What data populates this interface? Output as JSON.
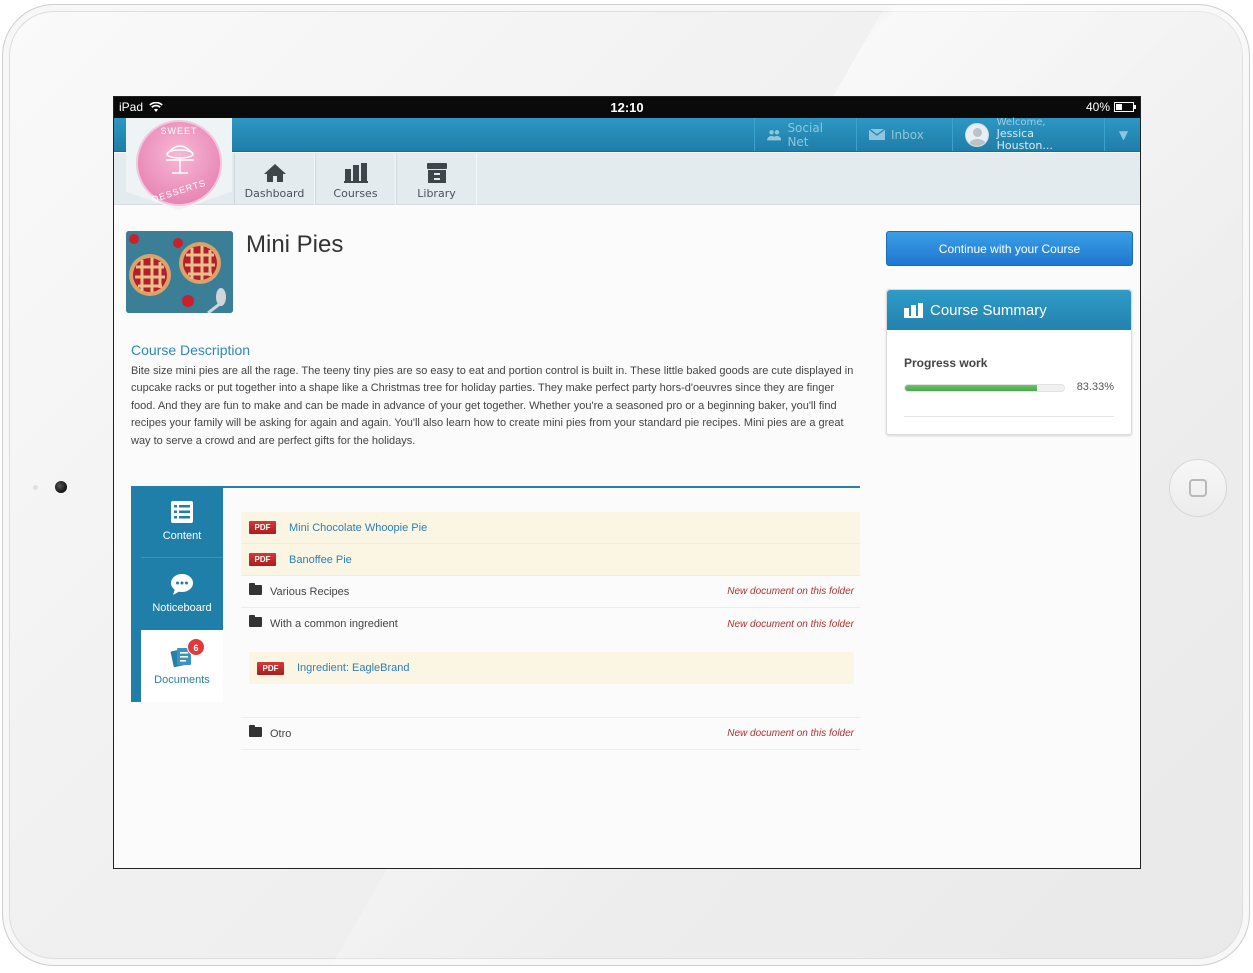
{
  "status_bar": {
    "device": "iPad",
    "time": "12:10",
    "battery": "40%",
    "battery_level": 0.4
  },
  "logo": {
    "top_text": "SWEET",
    "bottom_text": "DESSERTS"
  },
  "topbar": {
    "social_label": "Social Net",
    "inbox_label": "Inbox",
    "welcome_label": "Welcome,",
    "user_name": "Jessica Houston..."
  },
  "nav": {
    "dashboard": "Dashboard",
    "courses": "Courses",
    "library": "Library"
  },
  "course": {
    "title": "Mini Pies",
    "description_title": "Course Description",
    "description": "Bite size mini pies are all the rage. The teeny tiny pies are so easy to eat and portion control is built in. These little baked goods are cute displayed in cupcake racks or put together into a shape like a Christmas tree for holiday parties. They make perfect party hors-d'oeuvres since they are finger food. And they are fun to make and can be made in advance of your get together. Whether you're a seasoned pro or a beginning baker, you'll find recipes your family will be asking for again and again. You'll also learn how to create mini pies from your standard pie recipes. Mini pies are a great way to serve a crowd and are perfect gifts for the holidays."
  },
  "sidebar": {
    "continue_button": "Continue with your Course",
    "summary_title": "Course Summary",
    "progress_label": "Progress work",
    "progress_value": "83.33%",
    "progress_fraction": 0.8333
  },
  "tabs": {
    "content": "Content",
    "noticeboard": "Noticeboard",
    "documents": "Documents",
    "documents_badge": "6"
  },
  "documents": {
    "pdf_label": "PDF",
    "folder_note": "New document on this folder",
    "items": [
      {
        "kind": "pdf",
        "name": "Mini Chocolate Whoopie Pie"
      },
      {
        "kind": "pdf",
        "name": "Banoffee Pie"
      },
      {
        "kind": "folder",
        "name": "Various Recipes"
      },
      {
        "kind": "folder",
        "name": "With a common ingredient"
      },
      {
        "kind": "pdf",
        "name": "Ingredient: EagleBrand"
      },
      {
        "kind": "folder",
        "name": "Otro"
      }
    ]
  }
}
